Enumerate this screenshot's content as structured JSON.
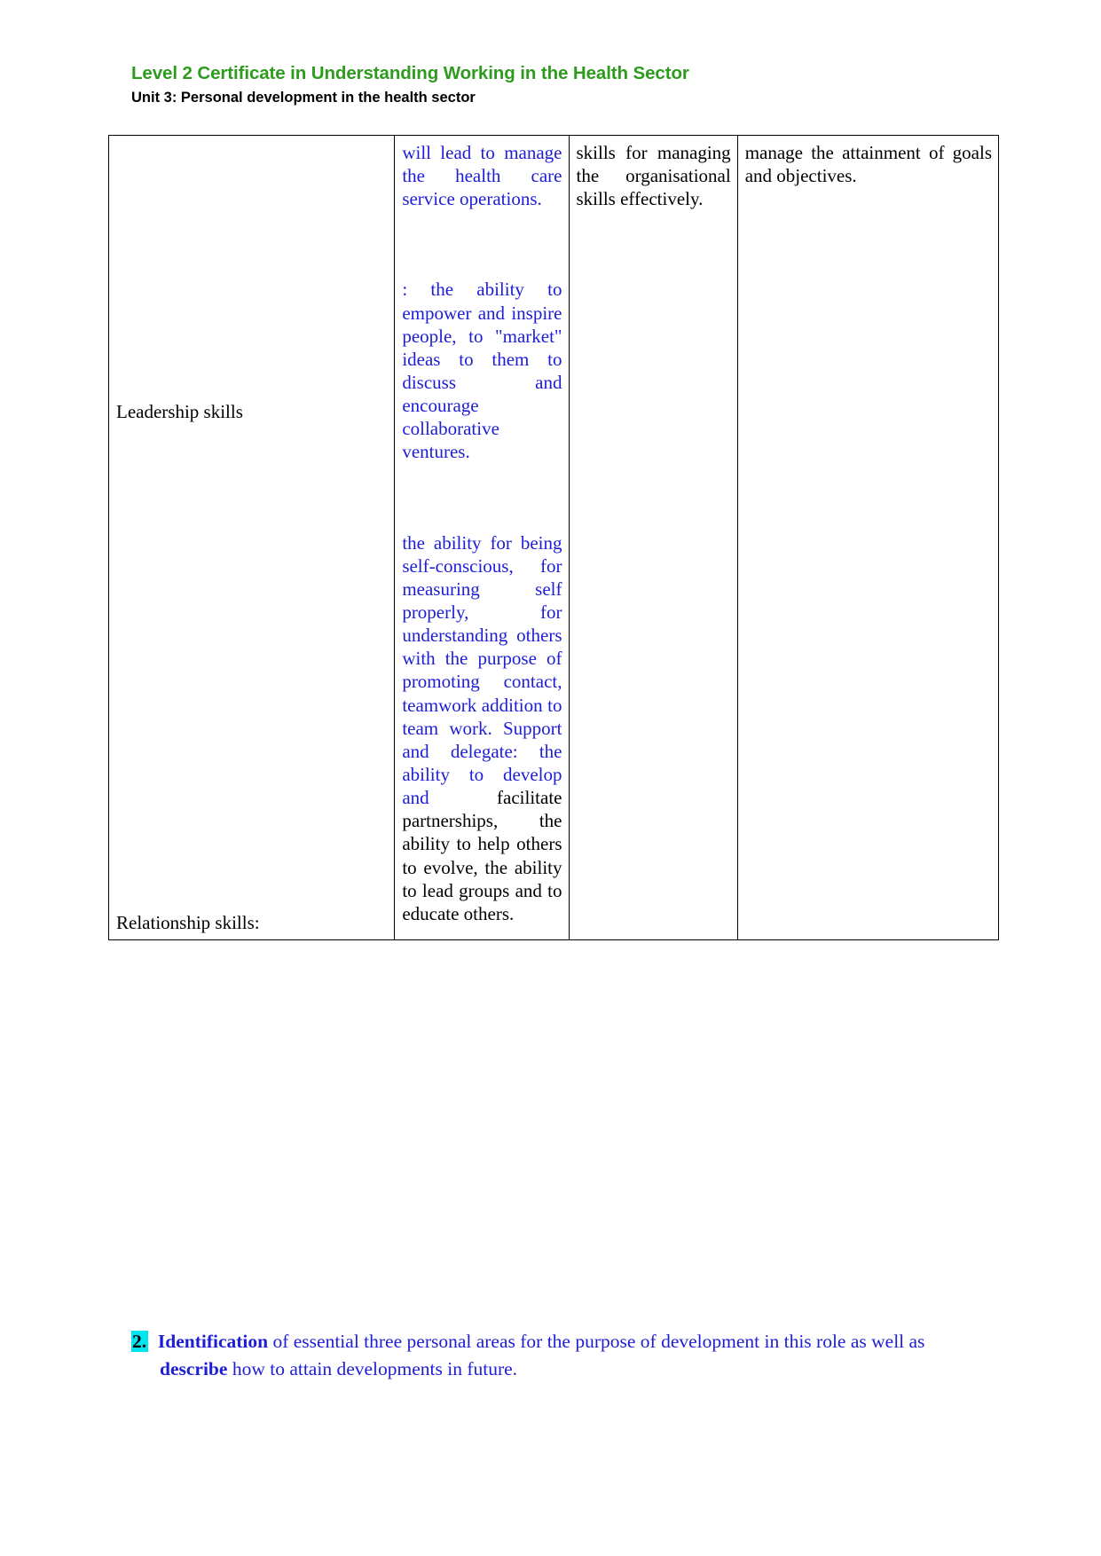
{
  "header": {
    "title": "Level 2 Certificate in Understanding Working in the Health Sector",
    "subtitle": "Unit 3: Personal development in the health sector"
  },
  "colors": {
    "title_green": "#2e9b1f",
    "body_blue": "#1d1dd6",
    "highlight_cyan": "#00e5ee",
    "text_black": "#000000",
    "table_border": "#000000"
  },
  "table": {
    "rows": [
      {
        "col1": "",
        "col2_blue_a": "will lead to manage the health care service operations.",
        "col2_blue_b": ": the ability to empower and inspire people, to \"market\" ideas to them to discuss and encourage collaborative ventures.",
        "col3": "skills for managing the organisational skills effectively.",
        "col4": "manage the attainment of goals and objectives."
      }
    ],
    "labels": {
      "leadership": "Leadership skills",
      "relationship": "Relationship skills:"
    },
    "relationship_text": {
      "blue_part": "the ability for being self-conscious, for measuring self properly, for understanding others with the purpose of promoting contact, teamwork addition to team work. Support and delegate: the ability to develop and",
      "black_part": "facilitate partnerships, the ability to help others to evolve, the ability to lead groups and to educate others."
    }
  },
  "bottom_paragraph": {
    "number": "2.",
    "bold_1": "Identification",
    "text_1": " of essential three personal areas for the purpose of development in this role",
    "text_2": "as well as ",
    "bold_2": "describe",
    "text_3": " how to attain developments in future."
  }
}
